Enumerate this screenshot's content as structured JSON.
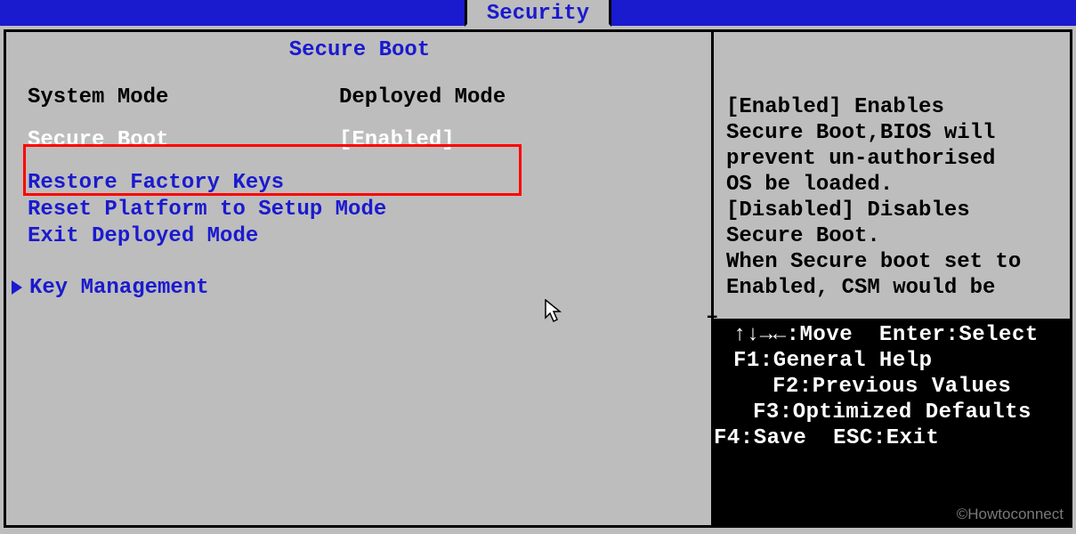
{
  "tab": {
    "active_label": "Security"
  },
  "section_title": "Secure Boot",
  "rows": {
    "system_mode": {
      "label": "System Mode",
      "value": "Deployed Mode"
    },
    "secure_boot": {
      "label": "Secure Boot",
      "value": "[Enabled]"
    }
  },
  "links": {
    "restore_keys": "Restore Factory Keys",
    "reset_platform": "Reset Platform to Setup Mode",
    "exit_deployed": "Exit Deployed Mode",
    "key_mgmt": "Key Management"
  },
  "help": {
    "l1": "[Enabled] Enables",
    "l2": "Secure Boot,BIOS will",
    "l3": "prevent un-authorised",
    "l4": "OS be loaded.",
    "l5": "[Disabled] Disables",
    "l6": "Secure Boot.",
    "l7": "When Secure boot set to",
    "l8": "Enabled, CSM would be"
  },
  "keys": {
    "r1": "↑↓→←:Move  Enter:Select",
    "r2": "F1:General Help",
    "r3": "F2:Previous Values",
    "r4": "F3:Optimized Defaults",
    "r5": "F4:Save  ESC:Exit"
  },
  "watermark": "©Howtoconnect"
}
